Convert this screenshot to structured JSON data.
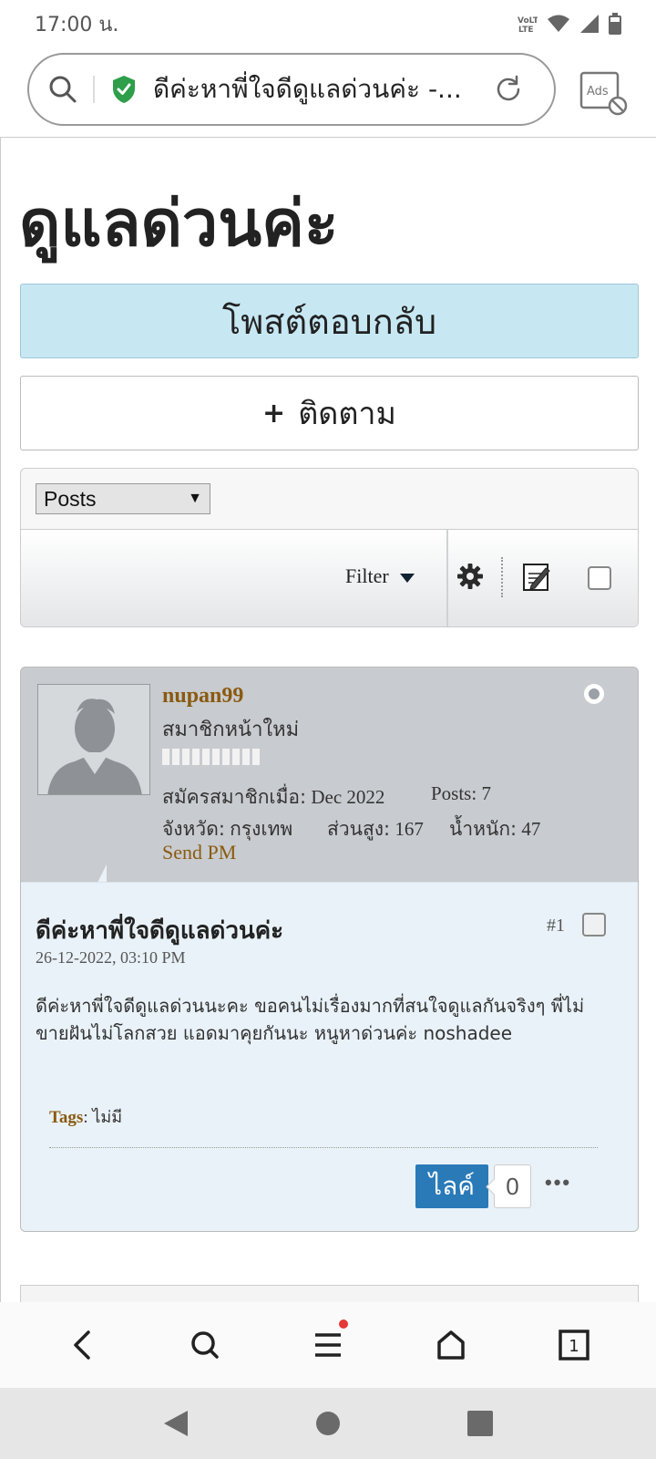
{
  "status_bar": {
    "time": "17:00 น.",
    "icons": [
      "volte-lte-icon",
      "wifi-icon",
      "signal-icon",
      "battery-icon"
    ]
  },
  "browser": {
    "url_text": "ดีค่ะหาพี่ใจดีดูแลด่วนค่ะ -...",
    "ads_label": "Ads",
    "tab_count": "1"
  },
  "page": {
    "title": "ดูแลด่วนค่ะ",
    "reply_button": "โพสต์ตอบกลับ",
    "follow_button": "ติดตาม",
    "follow_plus": "+",
    "view_select": "Posts",
    "filter_label": "Filter"
  },
  "post": {
    "username": "nupan99",
    "rank": "สมาชิกหน้าใหม่",
    "joined_label": "สมัครสมาชิกเมื่อ:",
    "joined_value": "Dec 2022",
    "posts_label": "Posts:",
    "posts_value": "7",
    "province_label": "จังหวัด:",
    "province_value": "กรุงเทพ",
    "height_label": "ส่วนสูง:",
    "height_value": "167",
    "weight_label": "น้ำหนัก:",
    "weight_value": "47",
    "send_pm": "Send PM",
    "title": "ดีค่ะหาพี่ใจดีดูแลด่วนค่ะ",
    "number": "#1",
    "date": "26-12-2022, 03:10 PM",
    "text": "ดีค่ะหาพี่ใจดีดูแลด่วนนะคะ ขอคนไม่เรื่องมากที่สนใจดูแลกันจริงๆ พี่ไม่ขายฝันไม่โลกสวย แอดมาคุยกันนะ หนูหาด่วนค่ะ noshadee",
    "tags_label": "Tags",
    "tags_value": "ไม่มี",
    "like_label": "ไลค์",
    "like_count": "0",
    "more_label": "•••"
  },
  "colors": {
    "reply_bg": "#c7e8f3",
    "username": "#8a5a10",
    "like_bg": "#2a7ab8",
    "post_body_bg": "#e9f2f8",
    "post_header_bg": "#c8cbcf"
  }
}
